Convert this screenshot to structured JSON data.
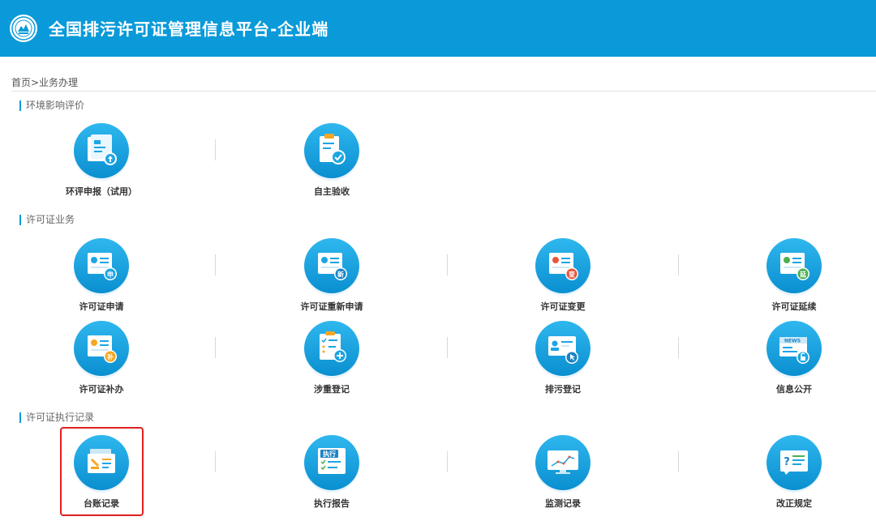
{
  "header": {
    "title": "全国排污许可证管理信息平台-企业端"
  },
  "breadcrumb": "首页>业务办理",
  "sections": [
    {
      "title": "环境影响评价",
      "items": [
        {
          "label": "环评申报（试用）",
          "icon": "document-upload-icon"
        },
        {
          "label": "自主验收",
          "icon": "clipboard-check-icon"
        }
      ]
    },
    {
      "title": "许可证业务",
      "items": [
        {
          "label": "许可证申请",
          "icon": "certificate-apply-icon",
          "badge": "申"
        },
        {
          "label": "许可证重新申请",
          "icon": "certificate-reapply-icon",
          "badge": "新"
        },
        {
          "label": "许可证变更",
          "icon": "certificate-change-icon",
          "badge": "变"
        },
        {
          "label": "许可证延续",
          "icon": "certificate-renew-icon",
          "badge": "延"
        },
        {
          "label": "许可证补办",
          "icon": "certificate-reissue-icon",
          "badge": "补"
        },
        {
          "label": "涉重登记",
          "icon": "checklist-add-icon"
        },
        {
          "label": "排污登记",
          "icon": "id-card-click-icon"
        },
        {
          "label": "信息公开",
          "icon": "news-icon",
          "badge": "NEWS"
        }
      ]
    },
    {
      "title": "许可证执行记录",
      "items": [
        {
          "label": "台账记录",
          "icon": "ledger-icon"
        },
        {
          "label": "执行报告",
          "icon": "report-icon",
          "badge": "执行"
        },
        {
          "label": "监测记录",
          "icon": "monitor-chart-icon"
        },
        {
          "label": "改正规定",
          "icon": "correction-help-icon",
          "badge": "?"
        }
      ]
    }
  ],
  "colors": {
    "header_bg": "#0a9ad9",
    "icon_blue": "#1aa6e4",
    "badge_red": "#e8553d",
    "badge_green": "#4caf50",
    "badge_orange": "#f5a623",
    "highlight": "#e02020"
  }
}
